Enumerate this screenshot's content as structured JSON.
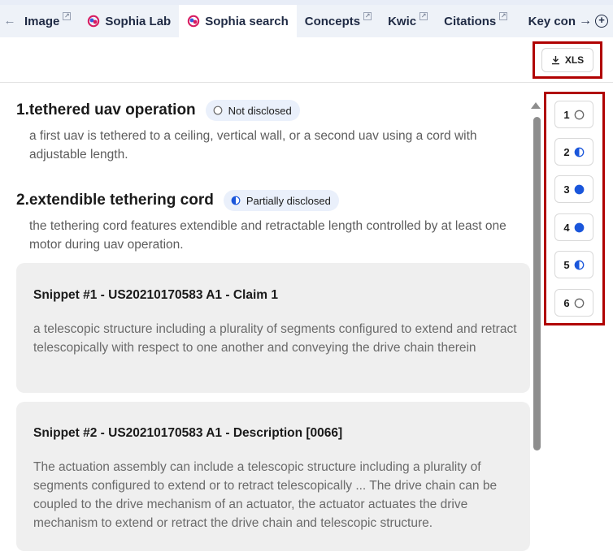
{
  "tabs": {
    "back_glyph": "←",
    "items": [
      {
        "label": "Image",
        "external": true,
        "icon": "external-link-icon",
        "active": false
      },
      {
        "label": "Sophia Lab",
        "icon": "sophia-logo-icon",
        "active": false
      },
      {
        "label": "Sophia search",
        "icon": "sophia-logo-icon",
        "active": true
      },
      {
        "label": "Concepts",
        "external": true,
        "icon": "external-link-icon",
        "active": false
      },
      {
        "label": "Kwic",
        "external": true,
        "icon": "external-link-icon",
        "active": false
      },
      {
        "label": "Citations",
        "external": true,
        "icon": "external-link-icon",
        "active": false
      }
    ],
    "overflow_label": "Key con",
    "next_glyph": "→",
    "add_glyph": "+"
  },
  "toolbar": {
    "xls_label": "XLS",
    "xls_icon": "download-icon"
  },
  "items": [
    {
      "title": "1.tethered uav operation",
      "status": "Not disclosed",
      "status_icon": "empty-circle-icon",
      "description": "a first uav is tethered to a ceiling, vertical wall, or a second uav using a cord with adjustable length."
    },
    {
      "title": "2.extendible tethering cord",
      "status": "Partially disclosed",
      "status_icon": "half-circle-icon",
      "description": "the tethering cord features extendible and retractable length controlled by at least one motor during uav operation."
    }
  ],
  "snippets": [
    {
      "title": "Snippet #1 - US20210170583 A1 - Claim 1",
      "text": "a telescopic structure including a plurality of segments configured to extend and retract telescopically with respect to one another and conveying the drive chain therein"
    },
    {
      "title": "Snippet #2 - US20210170583 A1 - Description [0066]",
      "text": "The actuation assembly can include a telescopic structure including a plurality of segments configured to extend or to retract telescopically ... The drive chain can be coupled to the drive mechanism of an actuator, the actuator actuates the drive mechanism to extend or retract the drive chain and telescopic structure."
    }
  ],
  "nav": [
    {
      "label": "1",
      "status": "empty"
    },
    {
      "label": "2",
      "status": "half"
    },
    {
      "label": "3",
      "status": "full"
    },
    {
      "label": "4",
      "status": "full"
    },
    {
      "label": "5",
      "status": "half"
    },
    {
      "label": "6",
      "status": "empty"
    }
  ],
  "colors": {
    "accent_blue": "#1a56db",
    "highlight_red": "#b00000",
    "badge_bg": "#eaf0fb",
    "snippet_bg": "#efefef"
  }
}
